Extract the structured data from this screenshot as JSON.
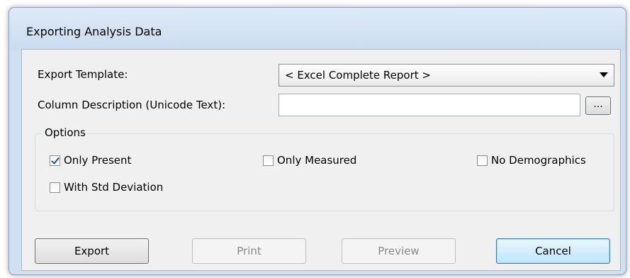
{
  "window": {
    "title": "Exporting Analysis Data"
  },
  "form": {
    "export_template_label": "Export Template:",
    "export_template_value": "< Excel Complete Report >",
    "column_description_label": "Column Description (Unicode Text):",
    "column_description_value": "",
    "browse_label": "..."
  },
  "options": {
    "legend": "Options",
    "items": [
      {
        "label": "Only Present",
        "checked": true
      },
      {
        "label": "Only Measured",
        "checked": false
      },
      {
        "label": "No Demographics",
        "checked": false
      },
      {
        "label": "With Std Deviation",
        "checked": false
      }
    ]
  },
  "buttons": {
    "export": "Export",
    "print": "Print",
    "preview": "Preview",
    "cancel": "Cancel"
  }
}
